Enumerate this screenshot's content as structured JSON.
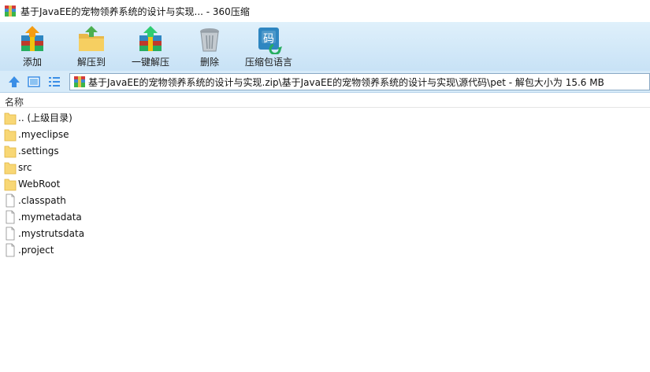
{
  "window": {
    "title": "基于JavaEE的宠物领养系统的设计与实现... - 360压缩"
  },
  "toolbar": {
    "buttons": [
      {
        "label": "添加",
        "icon": "add-archive-icon"
      },
      {
        "label": "解压到",
        "icon": "extract-to-icon"
      },
      {
        "label": "一键解压",
        "icon": "one-click-extract-icon"
      },
      {
        "label": "删除",
        "icon": "trash-can-icon"
      },
      {
        "label": "压缩包语言",
        "icon": "archive-language-icon"
      }
    ],
    "language_glyph": "码"
  },
  "navbar": {
    "path": "基于JavaEE的宠物领养系统的设计与实现.zip\\基于JavaEE的宠物领养系统的设计与实现\\源代码\\pet - 解包大小为 15.6 MB"
  },
  "list": {
    "column_name": "名称",
    "items": [
      {
        "name": ".. (上级目录)",
        "type": "folder"
      },
      {
        "name": ".myeclipse",
        "type": "folder"
      },
      {
        "name": ".settings",
        "type": "folder"
      },
      {
        "name": "src",
        "type": "folder"
      },
      {
        "name": "WebRoot",
        "type": "folder"
      },
      {
        "name": ".classpath",
        "type": "file"
      },
      {
        "name": ".mymetadata",
        "type": "file"
      },
      {
        "name": ".mystrutsdata",
        "type": "file"
      },
      {
        "name": ".project",
        "type": "file"
      }
    ]
  },
  "colors": {
    "toolbar_bg": "#c8e2f6",
    "nav_bg": "#d7ebf9",
    "folder": "#f8d775",
    "accent": "#2f7fd0"
  }
}
